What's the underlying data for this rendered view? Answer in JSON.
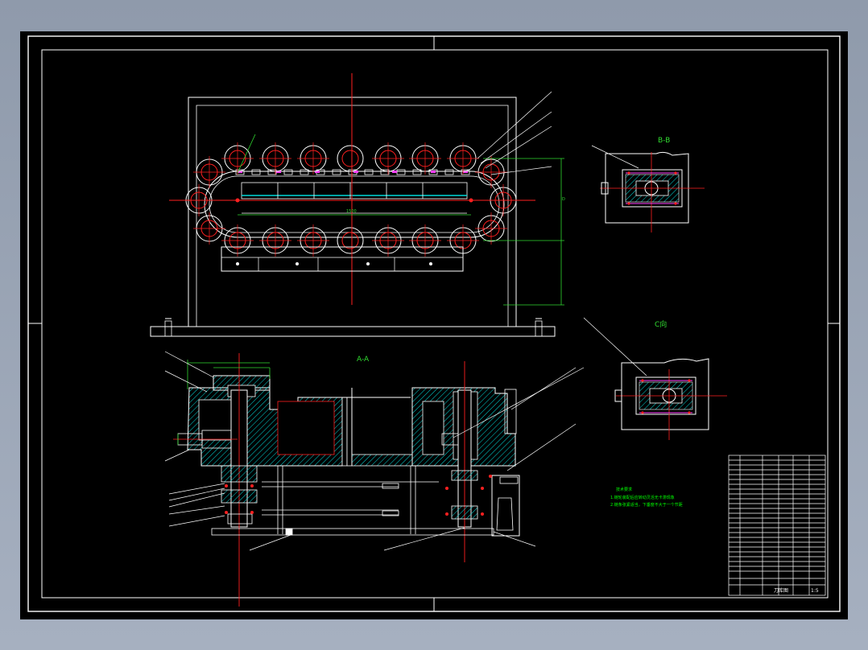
{
  "views": {
    "section_aa_label": "A-A",
    "section_bb_label": "B-B",
    "view_c_label": "C向"
  },
  "tech_notes": {
    "title": "技术要求",
    "lines": [
      "1.链轮装配后应转动灵活无卡滞现象",
      "2.链条张紧适当，下垂度不大于一个节距"
    ]
  },
  "title_block": {
    "drawing_name": "刀库图",
    "scale": "1:5"
  },
  "colors": {
    "sheet": "#000000",
    "frame": "#ffffff",
    "centerline": "#ff2020",
    "part": "#ffffff",
    "hatch": "#00e0e0",
    "dimension": "#30d830",
    "hidden": "#ff40ff",
    "leader": "#ffffff",
    "note": "#00ff00"
  }
}
